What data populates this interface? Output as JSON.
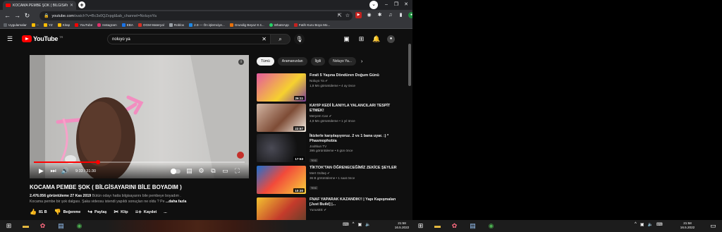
{
  "browser": {
    "tab_title": "KOCAMA PEMBE ŞOK ( BİLGİSAYA...",
    "url_host": "youtube.com",
    "url_rest": "/watch?v=Bc3s0QZxpgI&ab_channel=NoluyoYa",
    "new_tab": "+",
    "bookmarks": [
      {
        "label": "Uygulamalar",
        "color": "#5f6368"
      },
      {
        "label": "--",
        "color": "#fbbc04"
      },
      {
        "label": "YZ",
        "color": "#fbbc04"
      },
      {
        "label": "Kitap",
        "color": "#fbbc04"
      },
      {
        "label": "YouTube",
        "color": "#ff0000"
      },
      {
        "label": "Instagram",
        "color": "#e1306c"
      },
      {
        "label": "EBA",
        "color": "#1a73e8"
      },
      {
        "label": "OGM Materyal",
        "color": "#d93025"
      },
      {
        "label": "Roblox",
        "color": "#9aa0a6"
      },
      {
        "label": "2.9 — Ön işlemciye...",
        "color": "#1e88e5"
      },
      {
        "label": "Grundig Beyaz 8 4...",
        "color": "#e8710a"
      },
      {
        "label": "WhatsApp",
        "color": "#25d366"
      },
      {
        "label": "Fatih Kuru Boya Mo...",
        "color": "#c5221f"
      }
    ]
  },
  "youtube": {
    "logo": "YouTube",
    "logo_country": "TR",
    "search_query": "noluyo ya",
    "player": {
      "time": "9:33 / 31:30",
      "progress": 0.303
    },
    "video": {
      "title": "KOCAMA PEMBE ŞOK ( BİLGİSAYARINI BİLE BOYADIM )",
      "views": "2.476.056 görüntüleme",
      "date": "27 Kas 2019",
      "desc1": "Bütün odayı hatta bilgisayarını bile pembeye boyadım .",
      "desc2": "Kocama pembe bir şok dalgası. Şaka videosu istendi yapıldı sonuçları ne oldu ? Pe",
      "more": "...daha fazla",
      "likes": "81 B",
      "dislike": "Beğenme",
      "share": "Paylaş",
      "clip": "Klip",
      "save": "Kaydet",
      "overflow": "..."
    },
    "chips": [
      "Tümü",
      "Aramanızdan",
      "İlgili",
      "Noluyo Ya..."
    ],
    "recommendations": [
      {
        "title": "Fırat\\ 5 Yaşına Döndüren Doğum Günü",
        "channel": "Noluyo Ya",
        "stats": "1,8 Mn görüntüleme • 4 ay önce",
        "duration": "26:11",
        "verified": true,
        "badge": "",
        "thumb_color": "#cf3d86"
      },
      {
        "title": "KAYIP KEDİ İLANIYLA YALANCILARI TESPİT ETMEK!",
        "channel": "Meryem Can",
        "stats": "4,9 Mn görüntüleme • 1 yıl önce",
        "duration": "22:57",
        "verified": true,
        "badge": "",
        "thumb_color": "#8a5a3c"
      },
      {
        "title": "İkizlerle karşılaşıyoruz. 2 vs 1 bana uyar. :) * Phasmophobia",
        "channel": "Jooltkun TV",
        "stats": "395 görüntüleme • 6 gün önce",
        "duration": "17:53",
        "verified": false,
        "badge": "Yeni",
        "thumb_color": "#1d1d22"
      },
      {
        "title": "TİKTOK'TAN ÖĞRENECEĞİMİZ ZEKİCE ŞEYLER",
        "channel": "Mert Gültaş",
        "stats": "36 B görüntüleme • 1 saat önce",
        "duration": "10:30",
        "verified": true,
        "badge": "Yeni",
        "thumb_color": "#3b7bd8"
      },
      {
        "title": "FNAF YAPARAK KAZANDIK!! | Yapı Kapışmaları [Just Build] |...",
        "channel": "YunusEE",
        "stats": "",
        "duration": "",
        "verified": true,
        "badge": "",
        "thumb_color": "#e3c046"
      }
    ]
  },
  "taskbar": {
    "time": "21:58",
    "date": "16.5.2022",
    "time2": "21:58",
    "date2": "16.5.2022"
  }
}
